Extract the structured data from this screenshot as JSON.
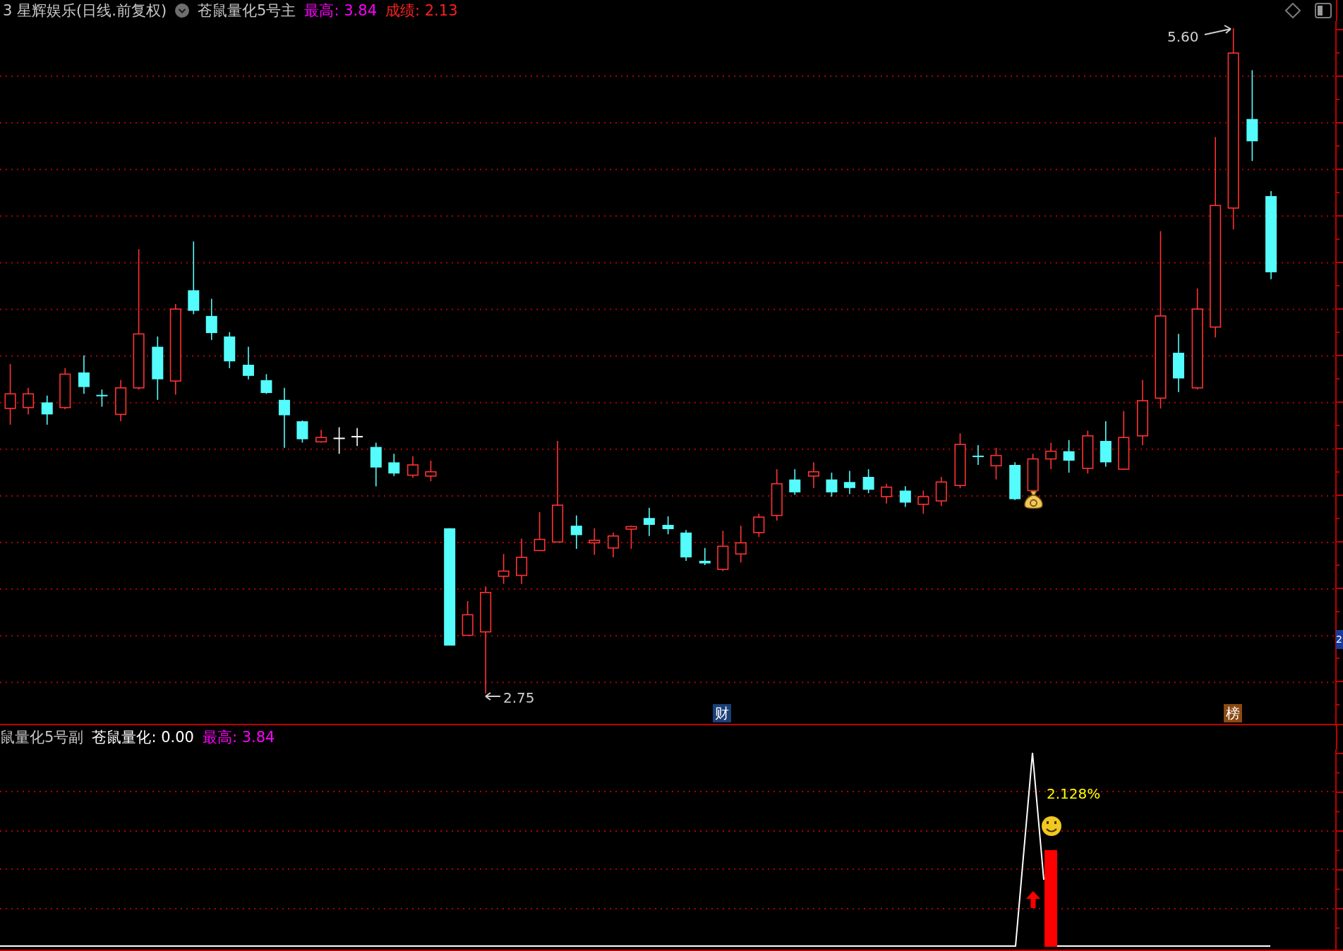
{
  "title_bar": {
    "stock": "3 星辉娱乐(日线.前复权)",
    "indicator": "苍鼠量化5号主",
    "readouts": [
      {
        "text": "最高: 3.84",
        "color": "#ff00ff"
      },
      {
        "text": "成绩: 2.13",
        "color": "#ff2020"
      }
    ]
  },
  "main_chart": {
    "high_label": "5.60",
    "low_label": "2.75",
    "event_tags": [
      {
        "text": "财",
        "color": "#1b3f78"
      },
      {
        "text": "榜",
        "color": "#8a4a12"
      }
    ],
    "axis_tag": "2"
  },
  "sub_chart": {
    "indicator": "鼠量化5号副",
    "readouts": [
      {
        "text": "苍鼠量化: 0.00",
        "color": "#ffffff"
      },
      {
        "text": "最高: 3.84",
        "color": "#ff00ff"
      }
    ],
    "signal_label": "2.128%"
  }
}
